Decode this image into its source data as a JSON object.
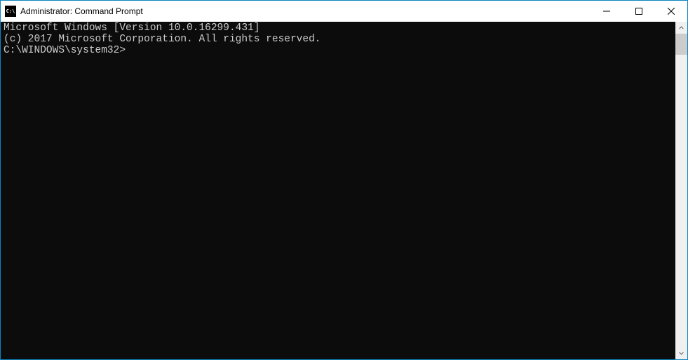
{
  "window": {
    "title": "Administrator: Command Prompt",
    "icon_label": "cmd-icon"
  },
  "terminal": {
    "lines": [
      "Microsoft Windows [Version 10.0.16299.431]",
      "(c) 2017 Microsoft Corporation. All rights reserved.",
      "",
      "C:\\WINDOWS\\system32>"
    ]
  }
}
